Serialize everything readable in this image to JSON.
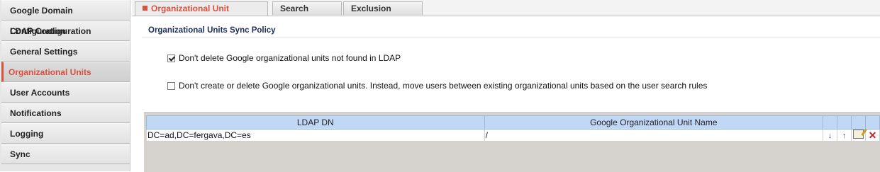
{
  "sidebar": {
    "items": [
      {
        "label": "Google Domain Configuration"
      },
      {
        "label": "LDAP Configuration"
      },
      {
        "label": "General Settings"
      },
      {
        "label": "Organizational Units",
        "active": true
      },
      {
        "label": "User Accounts"
      },
      {
        "label": "Notifications"
      },
      {
        "label": "Logging"
      },
      {
        "label": "Sync"
      }
    ]
  },
  "tabs": [
    {
      "label": "Organizational Unit Attributes",
      "active": true
    },
    {
      "label": "Search Rules"
    },
    {
      "label": "Exclusion Rules"
    }
  ],
  "policy": {
    "title": "Organizational Units Sync Policy",
    "options": [
      {
        "label": "Don't delete Google organizational units not found in LDAP",
        "checked": true
      },
      {
        "label": "Don't create or delete Google organizational units. Instead, move users between existing organizational units based on the user search rules",
        "checked": false
      }
    ]
  },
  "table": {
    "columns": [
      "LDAP DN",
      "Google Organizational Unit Name"
    ],
    "rows": [
      {
        "ldap_dn": "DC=ad,DC=fergava,DC=es",
        "ou_name": "/"
      }
    ]
  },
  "icons": {
    "move_down": "arrow-down-icon",
    "move_up": "arrow-up-icon",
    "edit": "edit-icon",
    "delete": "delete-icon"
  },
  "colors": {
    "accent": "#d9503f",
    "header": "#c0d8f5",
    "section_title": "#1d2c5b"
  }
}
